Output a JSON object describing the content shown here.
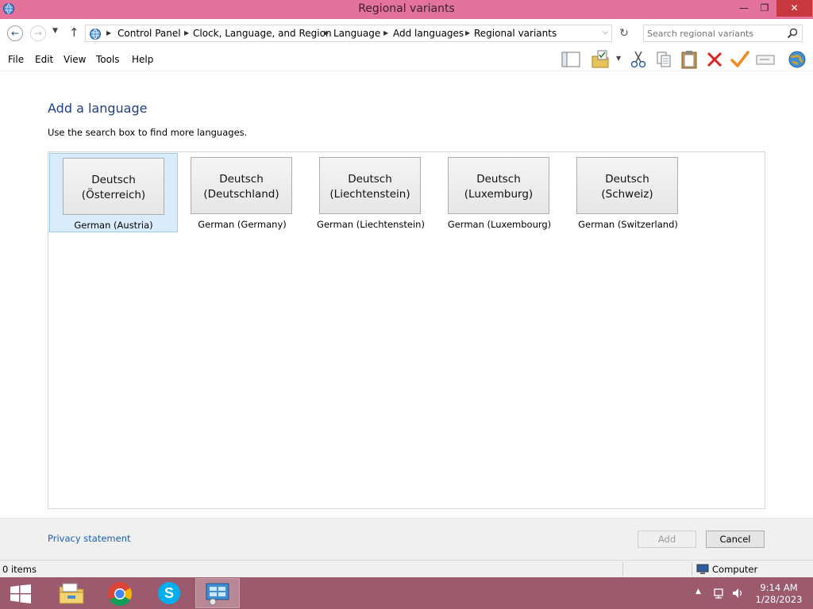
{
  "window": {
    "title": "Regional variants",
    "minimize_glyph": "—",
    "maximize_glyph": "❐",
    "close_glyph": "✕"
  },
  "address": {
    "breadcrumbs": [
      "Control Panel",
      "Clock, Language, and Region",
      "Language",
      "Add languages",
      "Regional variants"
    ],
    "search_placeholder": "Search regional variants"
  },
  "menu": {
    "items": [
      "File",
      "Edit",
      "View",
      "Tools",
      "Help"
    ]
  },
  "toolbar": {
    "icons": [
      "layout-pane-icon",
      "folder-options-icon",
      "cut-icon",
      "copy-icon",
      "paste-icon",
      "delete-icon",
      "properties-check-icon",
      "rename-icon",
      "globe-icon"
    ]
  },
  "content": {
    "heading": "Add a language",
    "instructions": "Use the search box to find more languages.",
    "languages": [
      {
        "native_line1": "Deutsch",
        "native_line2": "(Österreich)",
        "english": "German (Austria)",
        "selected": true
      },
      {
        "native_line1": "Deutsch",
        "native_line2": "(Deutschland)",
        "english": "German (Germany)",
        "selected": false
      },
      {
        "native_line1": "Deutsch",
        "native_line2": "(Liechtenstein)",
        "english": "German (Liechtenstein)",
        "selected": false
      },
      {
        "native_line1": "Deutsch",
        "native_line2": "(Luxemburg)",
        "english": "German (Luxembourg)",
        "selected": false
      },
      {
        "native_line1": "Deutsch",
        "native_line2": "(Schweiz)",
        "english": "German (Switzerland)",
        "selected": false
      }
    ]
  },
  "footer": {
    "privacy_link": "Privacy statement",
    "add_button": "Add",
    "cancel_button": "Cancel"
  },
  "statusbar": {
    "item_count": "0 items",
    "location": "Computer"
  },
  "taskbar": {
    "apps": [
      "file-explorer",
      "chrome",
      "skype",
      "control-panel"
    ],
    "clock_time": "9:14 AM",
    "clock_date": "1/28/2023"
  },
  "colors": {
    "titlebar": "#e3739b",
    "taskbar": "#9b5a6e",
    "heading": "#1e3f8a",
    "link": "#1e5fb4",
    "close_button": "#c7383f"
  }
}
